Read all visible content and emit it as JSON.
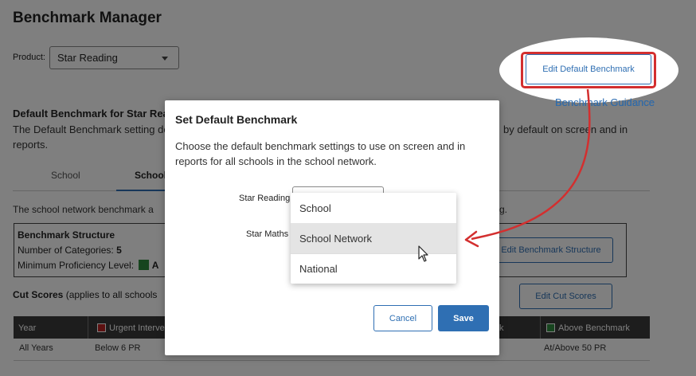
{
  "page": {
    "title": "Benchmark Manager",
    "product_label": "Product:",
    "product_value": "Star Reading",
    "edit_default_benchmark": "Edit Default Benchmark",
    "benchmark_guidance": "Benchmark Guidance",
    "default_benchmark_heading": "Default Benchmark for Star Read",
    "default_benchmark_desc_start": "The Default Benchmark setting de",
    "default_benchmark_desc_end": "by default on screen and in",
    "default_benchmark_desc_line2": "reports.",
    "tabs": [
      "School",
      "School"
    ],
    "network_text_start": "The school network benchmark a",
    "network_text_end": "g.",
    "structure": {
      "title": "Benchmark Structure",
      "categories_label": "Number of Categories:",
      "categories_value": "5",
      "min_prof_label": "Minimum Proficiency Level:",
      "min_prof_value": "A",
      "edit_button": "Edit Benchmark Structure"
    },
    "cut_scores_title": "Cut Scores",
    "cut_scores_note": "(applies to all schools",
    "edit_cut_scores": "Edit Cut Scores",
    "table": {
      "headers": [
        "Year",
        "Urgent Interve",
        "k",
        "Above Benchmark"
      ],
      "row": [
        "All Years",
        "Below 6 PR",
        "At/Above 50 PR"
      ]
    }
  },
  "modal": {
    "title": "Set Default Benchmark",
    "description": "Choose the default benchmark settings to use on screen and in reports for all schools in the school network.",
    "star_reading_label": "Star Reading",
    "star_maths_label": "Star Maths",
    "cancel": "Cancel",
    "save": "Save"
  },
  "dropdown": {
    "options": [
      "School",
      "School Network",
      "National"
    ],
    "highlighted": "School Network"
  },
  "colors": {
    "accent": "#2f6fb3",
    "annotation": "#d32f2f",
    "green": "#2e8b3e",
    "red": "#b22222"
  }
}
